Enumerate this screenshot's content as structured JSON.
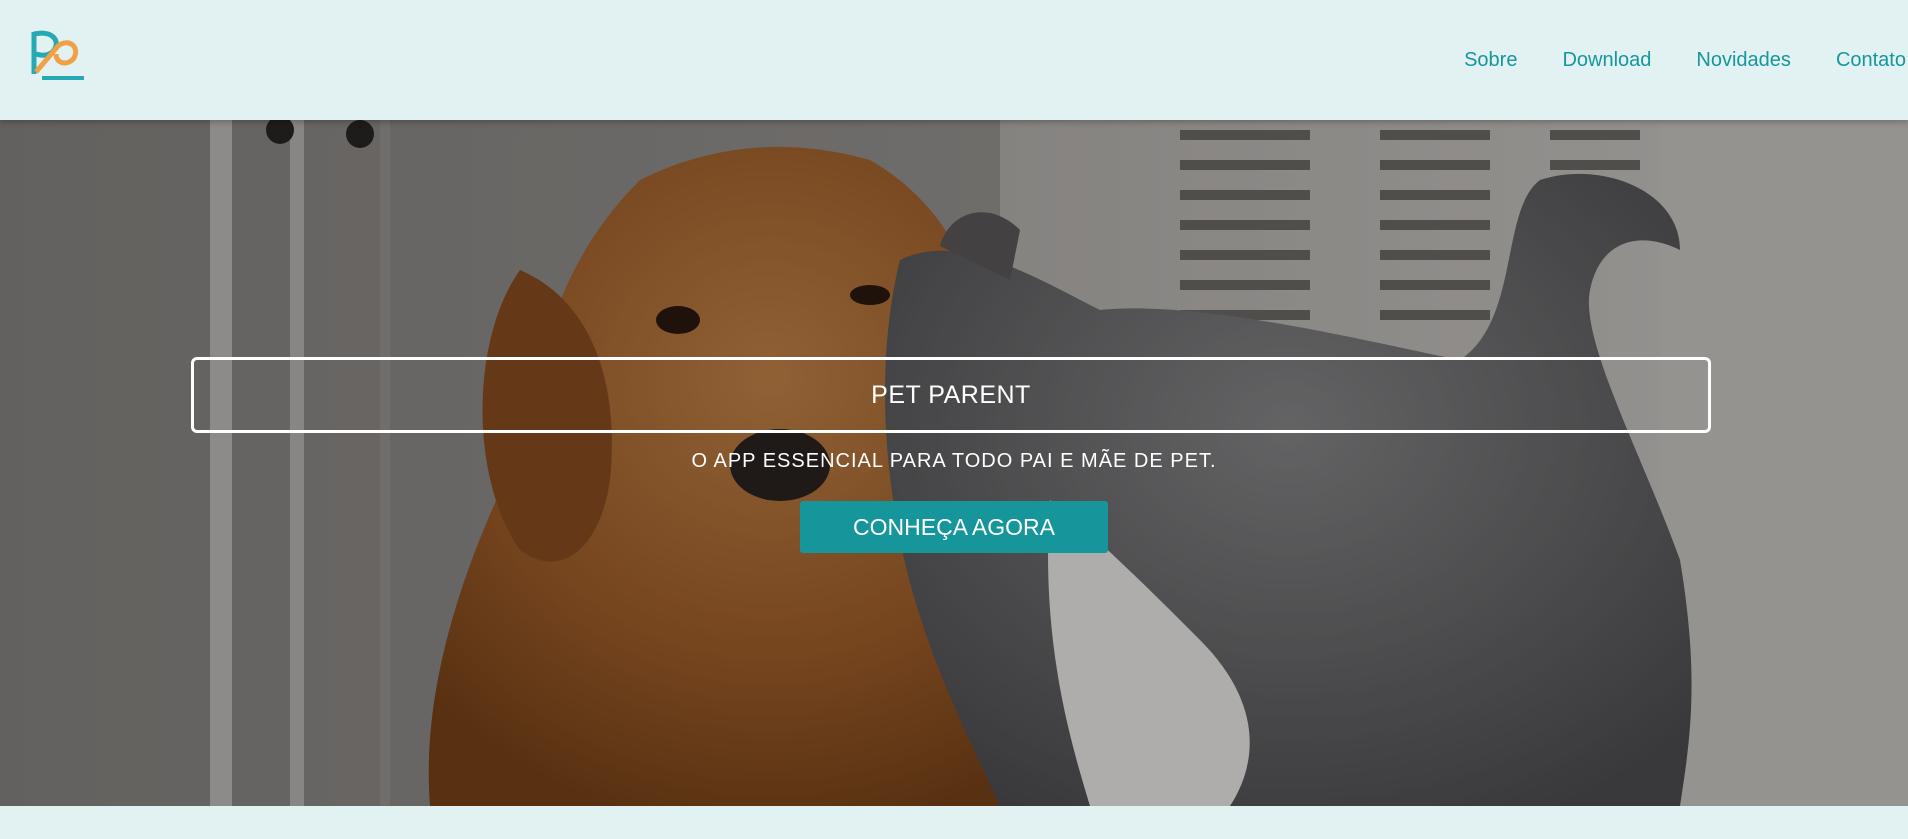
{
  "header": {
    "logo_icon": "pet-parent-logo",
    "nav": [
      {
        "label": "Sobre"
      },
      {
        "label": "Download"
      },
      {
        "label": "Novidades"
      },
      {
        "label": "Contato"
      }
    ]
  },
  "hero": {
    "background_image": "dog-and-cat-photo",
    "title": "PET PARENT",
    "subtitle": "O APP ESSENCIAL PARA TODO PAI E MÃE DE PET.",
    "cta_label": "CONHEÇA AGORA"
  },
  "colors": {
    "accent": "#16959b",
    "header_bg": "#e2f1f1",
    "logo_orange": "#f0a045",
    "logo_teal": "#26a9b3"
  }
}
